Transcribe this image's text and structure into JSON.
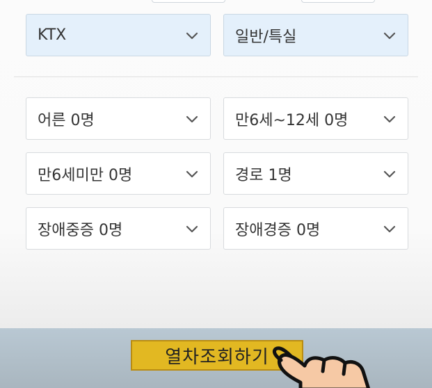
{
  "form": {
    "train_type": "KTX",
    "seat_class": "일반/특실",
    "passengers": {
      "adult": "어른 0명",
      "child": "만6세~12세 0명",
      "infant": "만6세미만 0명",
      "senior": "경로 1명",
      "disabled_severe": "장애중증 0명",
      "disabled_mild": "장애경증 0명"
    }
  },
  "action": {
    "search_label": "열차조회하기"
  },
  "colors": {
    "selected_field_bg": "#e4f0fb",
    "search_button_bg": "#e2b822",
    "footer_bg": "#b9c8d3"
  },
  "icons": {
    "dropdown": "chevron-down-icon",
    "pointer": "pointing-hand-icon"
  }
}
